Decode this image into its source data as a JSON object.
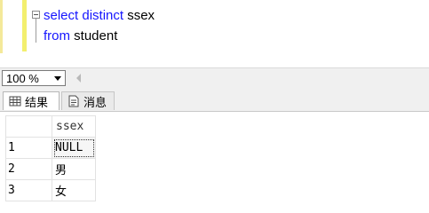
{
  "editor": {
    "lines": [
      {
        "keyword1": "select",
        "keyword2": "distinct",
        "text": "ssex"
      },
      {
        "keyword1": "from",
        "text": "student"
      }
    ]
  },
  "zoom": {
    "value": "100 %"
  },
  "tabs": [
    {
      "label": "结果",
      "icon": "grid-icon"
    },
    {
      "label": "消息",
      "icon": "message-icon"
    }
  ],
  "results": {
    "columns": [
      "ssex"
    ],
    "rows": [
      {
        "num": "1",
        "ssex": "NULL"
      },
      {
        "num": "2",
        "ssex": "男"
      },
      {
        "num": "3",
        "ssex": "女"
      }
    ]
  },
  "colors": {
    "keyword": "#1515ff",
    "selection_margin": "#f3ef6e"
  }
}
